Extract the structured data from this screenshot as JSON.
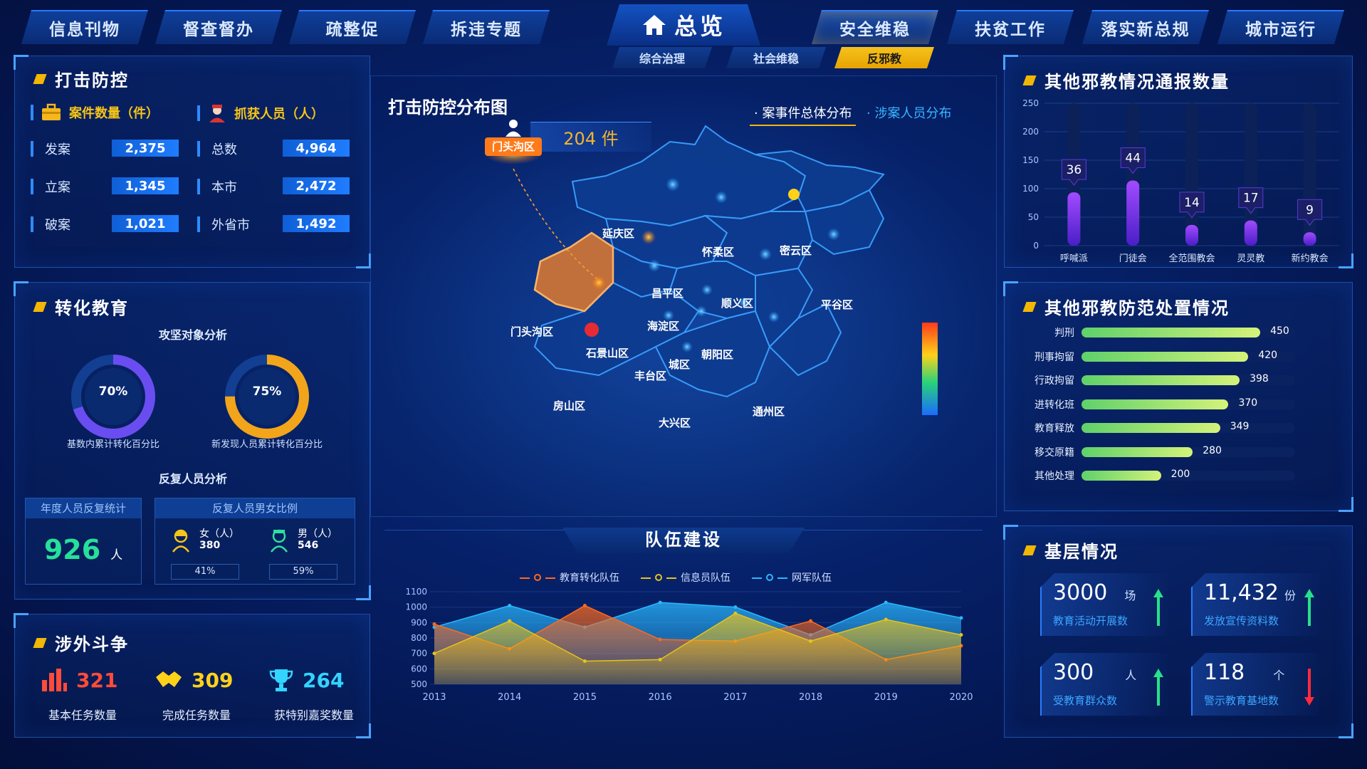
{
  "nav": {
    "left": [
      "信息刊物",
      "督查督办",
      "疏整促",
      "拆违专题"
    ],
    "home": "总览",
    "right": [
      "安全维稳",
      "扶贫工作",
      "落实新总规",
      "城市运行"
    ],
    "sub": [
      "综合治理",
      "社会维稳",
      "反邪教"
    ]
  },
  "strike": {
    "title": "打击防控",
    "cases_label": "案件数量（件）",
    "arrest_label": "抓获人员（人）",
    "cases": [
      {
        "label": "发案",
        "value": "2,375"
      },
      {
        "label": "立案",
        "value": "1,345"
      },
      {
        "label": "破案",
        "value": "1,021"
      }
    ],
    "arrests": [
      {
        "label": "总数",
        "value": "4,964"
      },
      {
        "label": "本市",
        "value": "2,472"
      },
      {
        "label": "外省市",
        "value": "1,492"
      }
    ]
  },
  "transform": {
    "title": "转化教育",
    "subtitle1": "攻坚对象分析",
    "ring1": {
      "value": "70%",
      "pct": 70,
      "label": "基数内累计转化百分比"
    },
    "ring2": {
      "value": "75%",
      "pct": 75,
      "label": "新发现人员累计转化百分比"
    },
    "subtitle2": "反复人员分析",
    "annual_label": "年度人员反复统计",
    "annual_value": "926",
    "annual_unit": "人",
    "ratio_label": "反复人员男女比例",
    "female_label": "女（人）",
    "female_value": "380",
    "female_pct": "41%",
    "male_label": "男（人）",
    "male_value": "546",
    "male_pct": "59%"
  },
  "foreign": {
    "title": "涉外斗争",
    "items": [
      {
        "value": "321",
        "label": "基本任务数量",
        "color": "#ff4b3a"
      },
      {
        "value": "309",
        "label": "完成任务数量",
        "color": "#ffd21a"
      },
      {
        "value": "264",
        "label": "获特别嘉奖数量",
        "color": "#33d4ff"
      }
    ]
  },
  "map": {
    "title": "打击防控分布图",
    "tab1": "案事件总体分布",
    "tab2": "涉案人员分布",
    "count": "204 件",
    "highlight": "门头沟区",
    "districts": [
      "延庆区",
      "怀柔区",
      "密云区",
      "昌平区",
      "顺义区",
      "平谷区",
      "门头沟区",
      "海淀区",
      "石景山区",
      "朝阳区",
      "城区",
      "丰台区",
      "房山区",
      "大兴区",
      "通州区"
    ]
  },
  "team": {
    "title": "队伍建设",
    "legend": [
      "教育转化队伍",
      "信息员队伍",
      "网军队伍"
    ]
  },
  "chart_data": [
    {
      "type": "bar",
      "title": "其他邪教情况通报数量",
      "categories": [
        "呼喊派",
        "门徒会",
        "全范围教会",
        "灵灵教",
        "新约教会"
      ],
      "values": [
        36,
        44,
        14,
        17,
        9
      ],
      "ylim": [
        0,
        250
      ],
      "yticks": [
        0,
        50,
        100,
        150,
        200,
        250
      ]
    },
    {
      "type": "bar",
      "title": "其他邪教防范处置情况",
      "categories": [
        "判刑",
        "刑事拘留",
        "行政拘留",
        "进转化班",
        "教育释放",
        "移交原籍",
        "其他处理"
      ],
      "values": [
        450,
        420,
        398,
        370,
        349,
        280,
        200
      ],
      "xlim": [
        0,
        500
      ]
    },
    {
      "type": "area",
      "title": "队伍建设",
      "x": [
        "2013",
        "2014",
        "2015",
        "2016",
        "2017",
        "2018",
        "2019",
        "2020"
      ],
      "ylim": [
        500,
        1100
      ],
      "yticks": [
        500,
        600,
        700,
        800,
        900,
        1000,
        1100
      ],
      "series": [
        {
          "name": "教育转化队伍",
          "color": "#ff6a1a",
          "values": [
            890,
            730,
            1010,
            790,
            780,
            910,
            660,
            750
          ]
        },
        {
          "name": "信息员队伍",
          "color": "#e8c21a",
          "values": [
            700,
            910,
            650,
            660,
            960,
            780,
            920,
            820
          ]
        },
        {
          "name": "网军队伍",
          "color": "#2ab8ff",
          "values": [
            870,
            1010,
            870,
            1030,
            1000,
            820,
            1030,
            930
          ]
        }
      ]
    }
  ],
  "grassroots": {
    "title": "基层情况",
    "items": [
      {
        "value": "3000",
        "unit": "场",
        "label": "教育活动开展数",
        "trend": "up"
      },
      {
        "value": "11,432",
        "unit": "份",
        "label": "发放宣传资料数",
        "trend": "up"
      },
      {
        "value": "300",
        "unit": "人",
        "label": "受教育群众数",
        "trend": "up"
      },
      {
        "value": "118",
        "unit": "个",
        "label": "警示教育基地数",
        "trend": "down"
      }
    ]
  }
}
